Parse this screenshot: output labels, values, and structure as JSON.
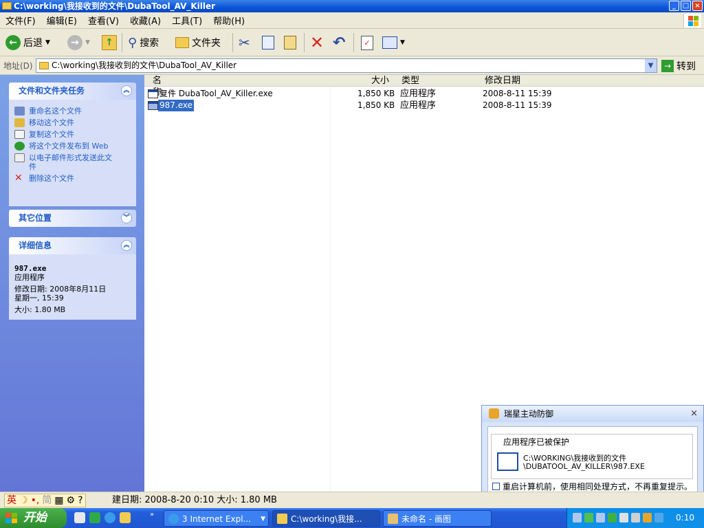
{
  "window": {
    "title": "C:\\working\\我接收到的文件\\DubaTool_AV_Killer"
  },
  "menu": [
    "文件(F)",
    "编辑(E)",
    "查看(V)",
    "收藏(A)",
    "工具(T)",
    "帮助(H)"
  ],
  "toolbar": {
    "back": "后退",
    "search": "搜索",
    "folders": "文件夹"
  },
  "address": {
    "label": "地址(D)",
    "value": "C:\\working\\我接收到的文件\\DubaTool_AV_Killer",
    "go": "转到"
  },
  "tasks": {
    "title": "文件和文件夹任务",
    "items": [
      "重命名这个文件",
      "移动这个文件",
      "复制这个文件",
      "将这个文件发布到 Web",
      "以电子邮件形式发送此文件",
      "删除这个文件"
    ]
  },
  "other_places": {
    "title": "其它位置"
  },
  "details": {
    "title": "详细信息",
    "name": "987.exe",
    "type": "应用程序",
    "modified": "修改日期: 2008年8月11日",
    "weekday": "星期一, 15:39",
    "size": "大小: 1.80 MB"
  },
  "columns": {
    "name": "名称",
    "size": "大小",
    "type": "类型",
    "modified": "修改日期"
  },
  "files": [
    {
      "name": "复件 DubaTool_AV_Killer.exe",
      "size": "1,850 KB",
      "type": "应用程序",
      "modified": "2008-8-11 15:39",
      "selected": false
    },
    {
      "name": "987.exe",
      "size": "1,850 KB",
      "type": "应用程序",
      "modified": "2008-8-11 15:39",
      "selected": true
    }
  ],
  "popup": {
    "title": "瑞星主动防御",
    "group": "应用程序已被保护",
    "path1": "C:\\WORKING\\我接收到的文件",
    "path2": "\\DUBATOOL_AV_KILLER\\987.EXE",
    "checkbox": "重启计算机前，使用相同处理方式，不再重复提示。"
  },
  "status": {
    "text": "建日期: 2008-8-20 0:10 大小: 1.80 MB",
    "ime_lang": "英",
    "ime_mode": "简"
  },
  "taskbar": {
    "start": "开始",
    "buttons": [
      "3 Internet Expl...",
      "C:\\working\\我接...",
      "未命名 - 画图"
    ],
    "clock": "0:10"
  }
}
